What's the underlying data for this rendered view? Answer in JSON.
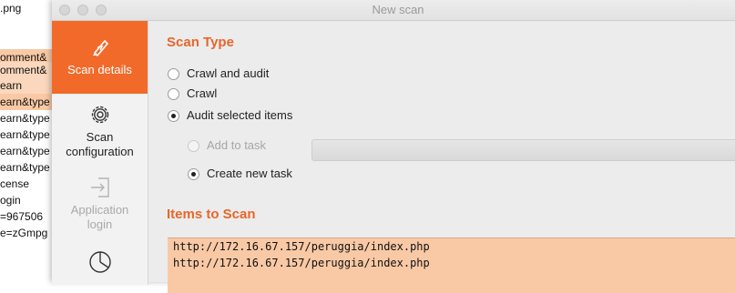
{
  "background_list": {
    "items": [
      ".png",
      "",
      "",
      "omment&",
      "omment&",
      "earn",
      "earn&type",
      "earn&type",
      "earn&type",
      "earn&type",
      "earn&type",
      "cense",
      "ogin",
      "=967506",
      "e=zGmpg"
    ]
  },
  "window": {
    "title": "New scan"
  },
  "sidebar": {
    "items": [
      {
        "label": "Scan details",
        "icon": "scan-details-icon",
        "state": "active"
      },
      {
        "label": "Scan configuration",
        "icon": "gear-icon",
        "state": "normal"
      },
      {
        "label": "Application login",
        "icon": "login-icon",
        "state": "disabled"
      },
      {
        "label": "",
        "icon": "pie-chart-icon",
        "state": "normal"
      }
    ]
  },
  "scan_type": {
    "title": "Scan Type",
    "options": [
      {
        "label": "Crawl and audit",
        "selected": false
      },
      {
        "label": "Crawl",
        "selected": false
      },
      {
        "label": "Audit selected items",
        "selected": true
      }
    ],
    "task_options": [
      {
        "label": "Add to task",
        "selected": false,
        "disabled": true
      },
      {
        "label": "Create new task",
        "selected": true,
        "disabled": false
      }
    ]
  },
  "items_to_scan": {
    "title": "Items to Scan",
    "rows": [
      "http://172.16.67.157/peruggia/index.php",
      "http://172.16.67.157/peruggia/index.php"
    ]
  },
  "colors": {
    "accent": "#f26a2a",
    "section_title": "#e8662a",
    "selection": "#f9c9a6"
  }
}
